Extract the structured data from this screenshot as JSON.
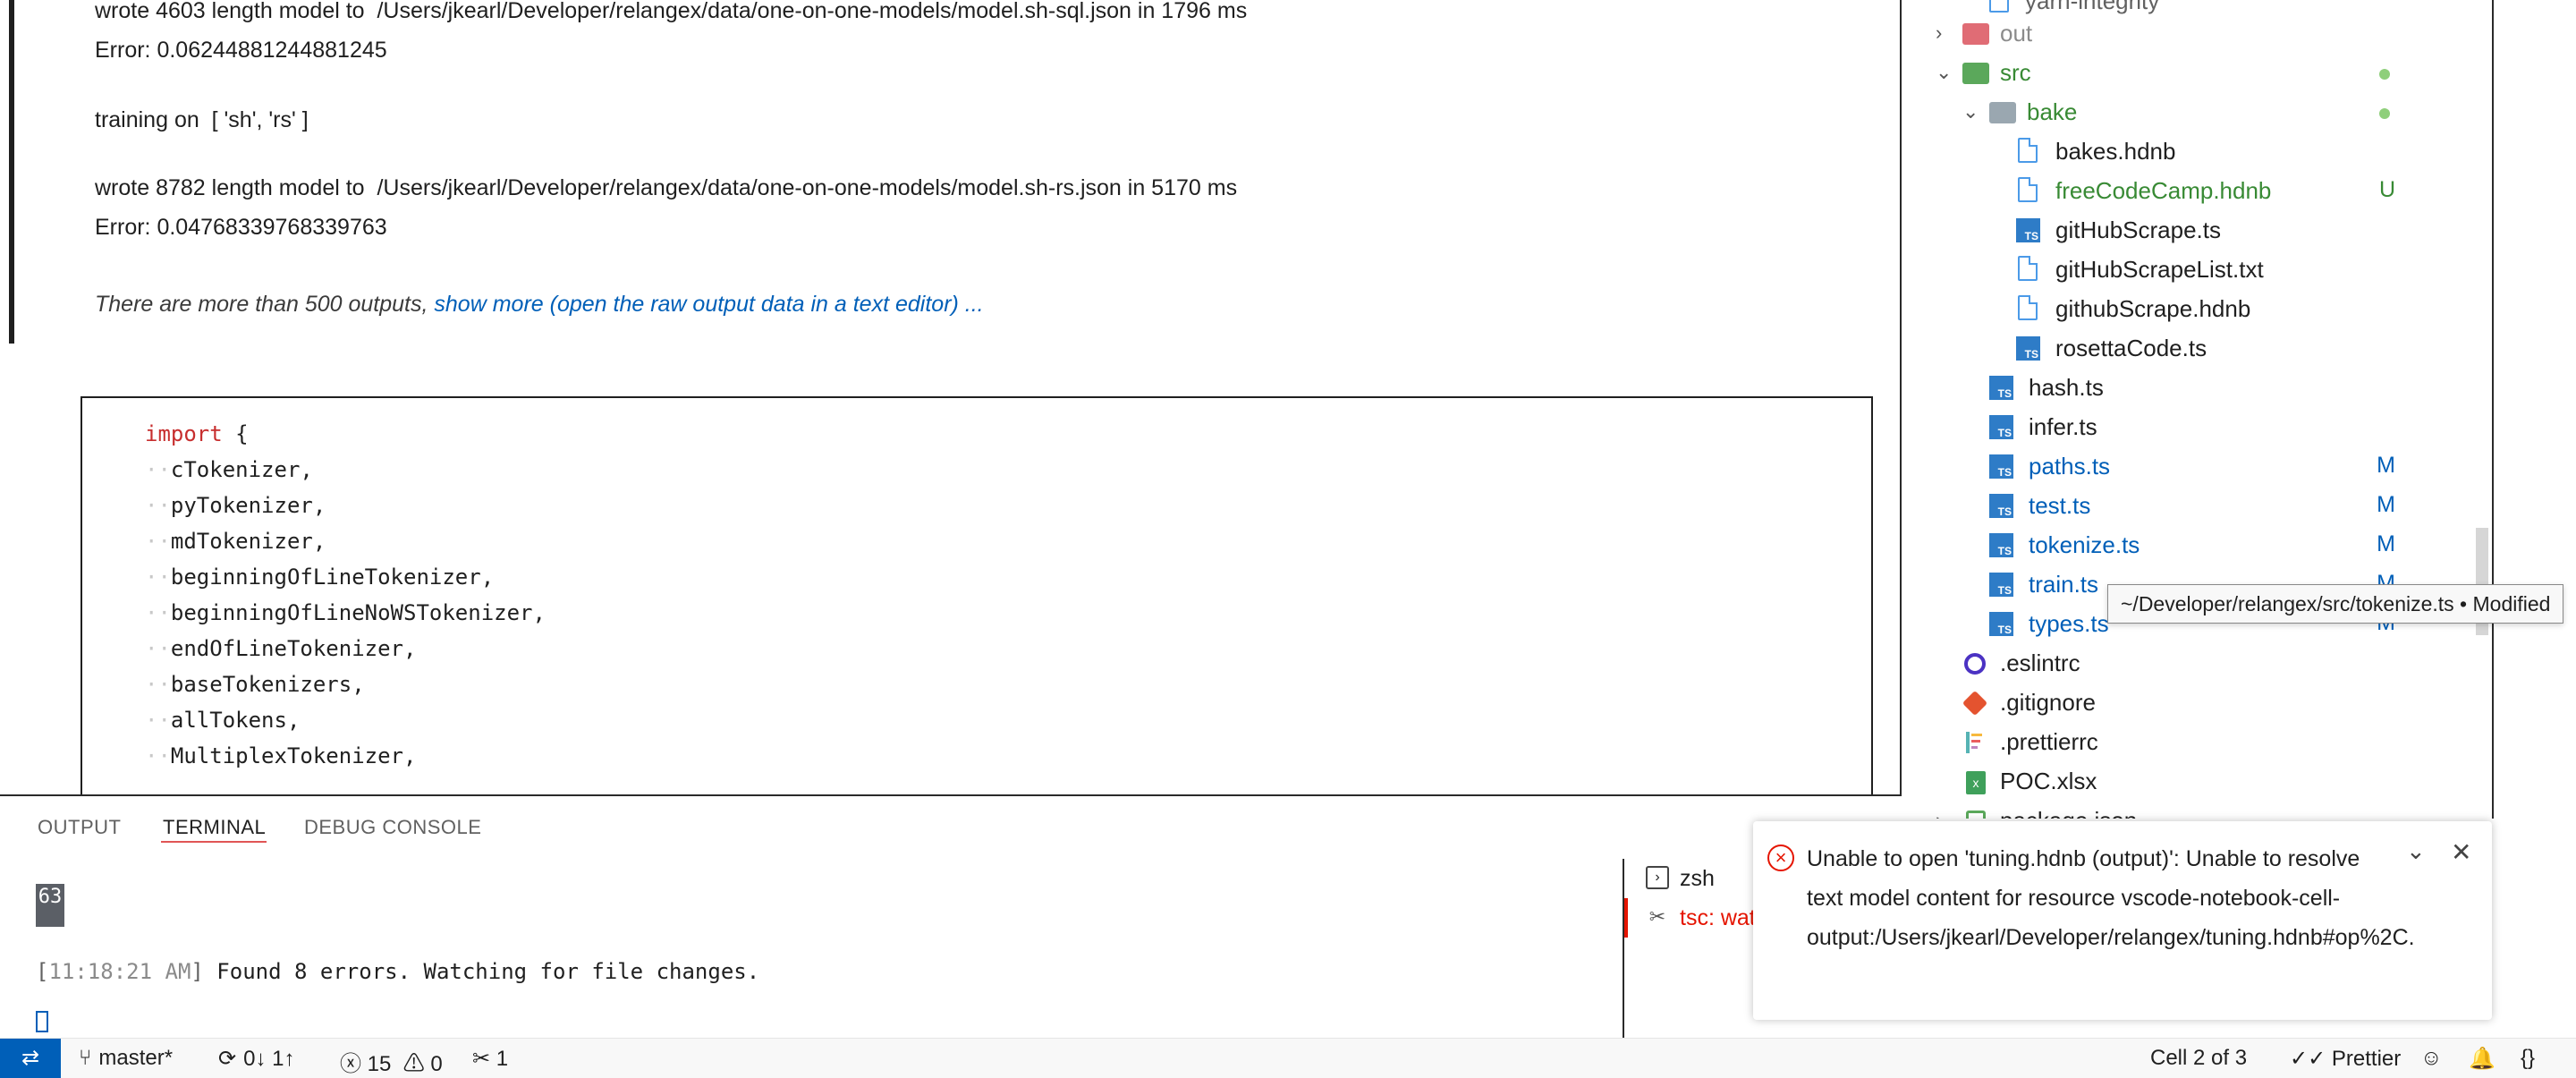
{
  "notebook": {
    "output_lines": [
      "wrote 4603 length model to  /Users/jkearl/Developer/relangex/data/one-on-one-models/model.sh-sql.json in 1796 ms",
      "Error: 0.06244881244881245",
      "training on  [ 'sh', 'rs' ]",
      "wrote 8782 length model to  /Users/jkearl/Developer/relangex/data/one-on-one-models/model.sh-rs.json in 5170 ms",
      "Error: 0.04768339768339763"
    ],
    "truncation_text": "There are more than 500 outputs, ",
    "truncation_link": "show more (open the raw output data in a text editor) ...",
    "code": {
      "keyword": "import",
      "brace": " {",
      "lines": [
        "cTokenizer,",
        "pyTokenizer,",
        "mdTokenizer,",
        "beginningOfLineTokenizer,",
        "beginningOfLineNoWSTokenizer,",
        "endOfLineTokenizer,",
        "baseTokenizers,",
        "allTokens,",
        "MultiplexTokenizer,"
      ]
    }
  },
  "explorer": {
    "items": [
      {
        "label": "yarn-integrity",
        "kind": "file",
        "color": "#616161"
      },
      {
        "label": "out",
        "kind": "folder-collapsed",
        "color": "#8b8b8b"
      },
      {
        "label": "src",
        "kind": "folder-open",
        "color": "#388a34",
        "decor": "dot"
      },
      {
        "label": "bake",
        "kind": "folder-open",
        "color": "#388a34",
        "decor": "dot"
      },
      {
        "label": "bakes.hdnb",
        "kind": "file",
        "color": "#1f1f1f"
      },
      {
        "label": "freeCodeCamp.hdnb",
        "kind": "file",
        "color": "#388a34",
        "badge": "U"
      },
      {
        "label": "gitHubScrape.ts",
        "kind": "ts",
        "color": "#1f1f1f"
      },
      {
        "label": "gitHubScrapeList.txt",
        "kind": "file",
        "color": "#1f1f1f"
      },
      {
        "label": "githubScrape.hdnb",
        "kind": "file",
        "color": "#1f1f1f"
      },
      {
        "label": "rosettaCode.ts",
        "kind": "ts",
        "color": "#1f1f1f"
      },
      {
        "label": "hash.ts",
        "kind": "ts",
        "color": "#1f1f1f"
      },
      {
        "label": "infer.ts",
        "kind": "ts",
        "color": "#1f1f1f"
      },
      {
        "label": "paths.ts",
        "kind": "ts",
        "color": "#005fb8",
        "badge": "M"
      },
      {
        "label": "test.ts",
        "kind": "ts",
        "color": "#005fb8",
        "badge": "M"
      },
      {
        "label": "tokenize.ts",
        "kind": "ts",
        "color": "#005fb8",
        "badge": "M"
      },
      {
        "label": "train.ts",
        "kind": "ts",
        "color": "#005fb8",
        "badge": "M"
      },
      {
        "label": "types.ts",
        "kind": "ts",
        "color": "#005fb8",
        "badge": "M"
      },
      {
        "label": ".eslintrc",
        "kind": "eslint",
        "color": "#1f1f1f"
      },
      {
        "label": ".gitignore",
        "kind": "git",
        "color": "#1f1f1f"
      },
      {
        "label": ".prettierrc",
        "kind": "prettier",
        "color": "#1f1f1f"
      },
      {
        "label": "POC.xlsx",
        "kind": "xlsx",
        "color": "#1f1f1f"
      },
      {
        "label": "package.json",
        "kind": "npm",
        "color": "#1f1f1f"
      }
    ],
    "tooltip": "~/Developer/relangex/src/tokenize.ts • Modified"
  },
  "panel": {
    "tabs": [
      "OUTPUT",
      "TERMINAL",
      "DEBUG CONSOLE"
    ],
    "active_tab": "TERMINAL",
    "terminal": {
      "number": "63",
      "time": "11:18:21 AM",
      "message": " Found 8 errors. Watching for file changes."
    },
    "terminals": [
      {
        "label": "zsh",
        "icon": "terminal-icon"
      },
      {
        "label": "tsc: watch",
        "icon": "tools-icon"
      }
    ]
  },
  "notification": {
    "message": "Unable to open 'tuning.hdnb (output)': Unable to resolve text model content for resource vscode-notebook-cell-output:/Users/jkearl/Developer/relangex/tuning.hdnb#op%2C.",
    "icon": "error-icon"
  },
  "statusbar": {
    "branch": "master*",
    "sync": "0↓ 1↑",
    "errors": "15",
    "warnings": "0",
    "ports": "1",
    "cell": "Cell 2 of 3",
    "formatter": "Prettier",
    "accent": "#005fb8"
  }
}
